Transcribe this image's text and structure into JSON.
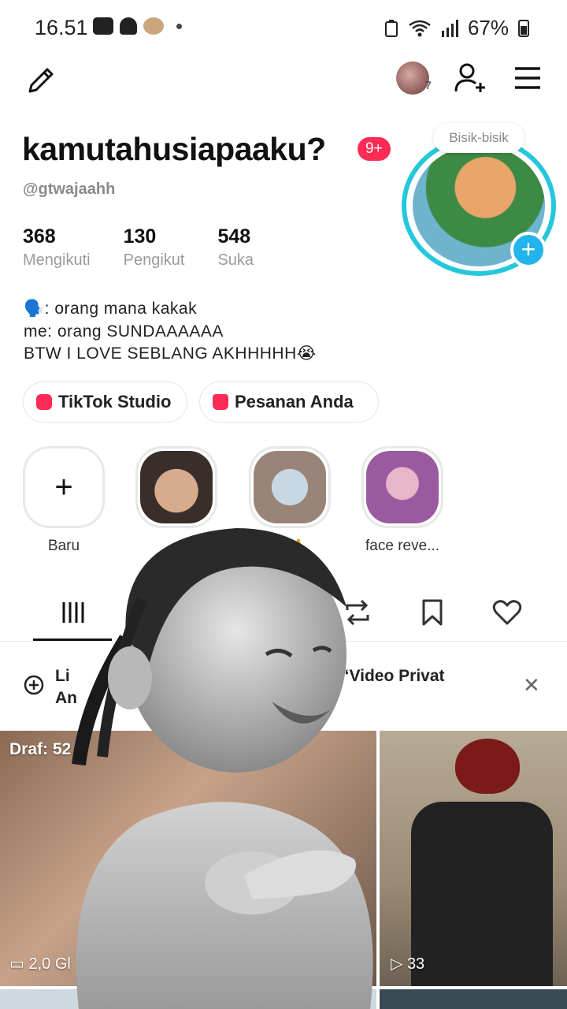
{
  "status_bar": {
    "time": "16.51",
    "battery": "67%"
  },
  "profile": {
    "username": "kamutahusiapaaku?",
    "notification_badge": "9+",
    "handle": "@gtwajaahh",
    "whisper_label": "Bisik-bisik",
    "nav_avatar_count": "7"
  },
  "stats": [
    {
      "value": "368",
      "label": "Mengikuti"
    },
    {
      "value": "130",
      "label": "Pengikut"
    },
    {
      "value": "548",
      "label": "Suka"
    }
  ],
  "bio": {
    "line1": "🗣️: orang mana kakak",
    "line2": "me: orang SUNDAAAAAA",
    "line3": "BTW I LOVE SEBLANG AKHHHHH😭"
  },
  "chips": {
    "studio": "TikTok Studio",
    "orders": "Pesanan Anda"
  },
  "highlights": [
    {
      "label": "Baru"
    },
    {
      "label": ""
    },
    {
      "label": "😭🙏"
    },
    {
      "label": "face reve..."
    }
  ],
  "banner": {
    "text_left": "Li",
    "text_left_2": "An",
    "text_right": "ir di “Video Privat"
  },
  "grid": {
    "draft_label": "Draf: 52",
    "size_label": "2,0 Gl",
    "views_label": "33"
  }
}
